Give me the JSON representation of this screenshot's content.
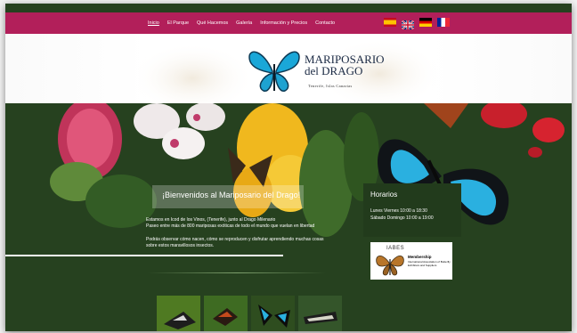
{
  "nav": {
    "items": [
      "Inicio",
      "El Parque",
      "Qué Hacemos",
      "Galería",
      "Información y Precios",
      "Contacto"
    ],
    "active_index": 0
  },
  "languages": [
    "Español",
    "English",
    "Deutsch",
    "Français"
  ],
  "logo": {
    "line1": "MARIPOSARIO",
    "line2": "del DRAGO",
    "subtitle": "Tenerife, Islas Canarias"
  },
  "welcome": {
    "title": "¡Bienvenidos al Mariposario del Drago!",
    "p1_line1": "Estamos en Icod de los Vinos, (Tenerife), junto al Drago Milenario",
    "p1_line2": "Paseo entre más de 800 mariposas exóticas de todo el mundo que vuelan en libertad",
    "p2_line1": "Podrás observar cómo nacen, cómo se reproducen y disfrutar aprendiendo muchas cosas",
    "p2_line2": "sobre estos maravillosos insectos."
  },
  "hours": {
    "title": "Horarios",
    "line1": "Lunes Viernes 10:00 a 18:30",
    "line2": "Sábado Domingo 10:00 a 19:00"
  },
  "badge": {
    "brand": "IABES",
    "title": "Membership",
    "desc": "International Association of Butterfly Exhibitors and Suppliers"
  },
  "colors": {
    "nav_bg": "#b21f5a",
    "page_bg": "#26411f",
    "panel_bg": "#223b1c"
  },
  "thumbnails": [
    "butterfly-thumb-1",
    "butterfly-thumb-2",
    "butterfly-thumb-3",
    "butterfly-thumb-4"
  ]
}
